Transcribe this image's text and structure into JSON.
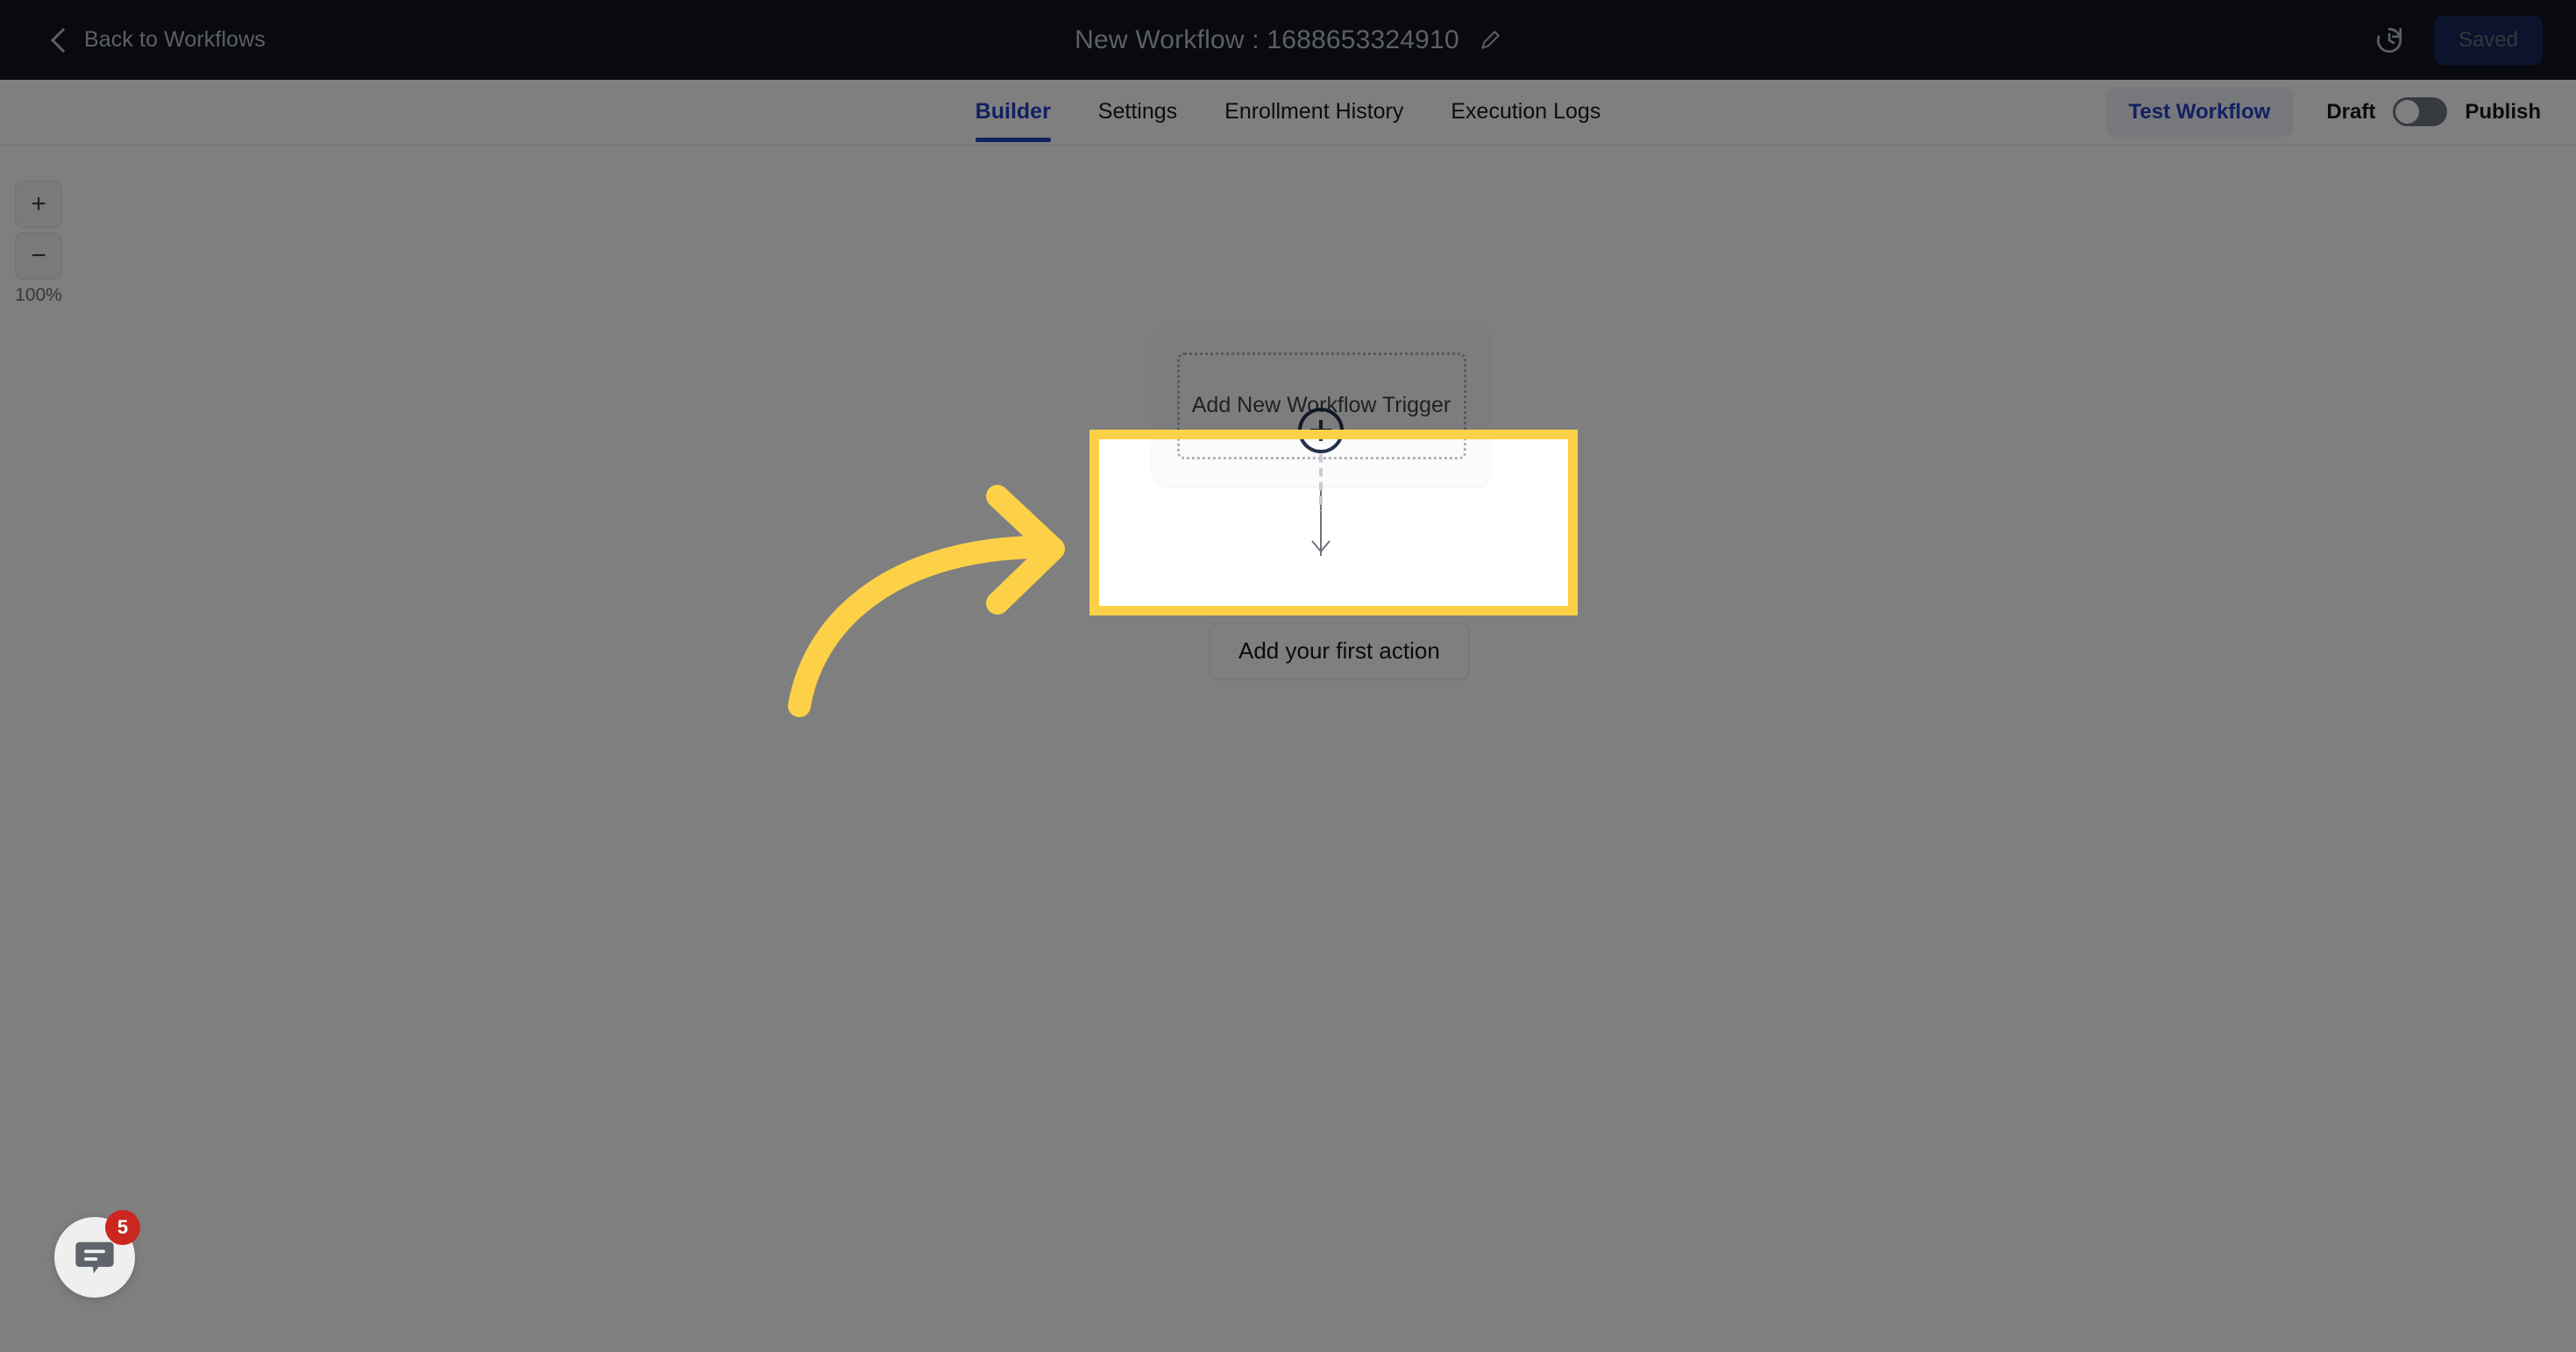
{
  "topbar": {
    "back_label": "Back to Workflows",
    "back_icon": "chevron-left-icon",
    "title": "New Workflow : 1688653324910",
    "edit_icon": "pencil-icon",
    "history_icon": "history-clock-icon",
    "save_label": "Saved",
    "bg_color": "#111520",
    "text_color": "#b9bec7",
    "save_bg_color": "#17265a"
  },
  "tabbar": {
    "tabs": [
      {
        "label": "Builder",
        "active": true
      },
      {
        "label": "Settings",
        "active": false
      },
      {
        "label": "Enrollment History",
        "active": false
      },
      {
        "label": "Execution Logs",
        "active": false
      }
    ],
    "test_workflow_label": "Test Workflow",
    "draft_label": "Draft",
    "publish_label": "Publish",
    "toggle_state": "off",
    "accent_color": "#2241c4"
  },
  "canvas": {
    "zoom": {
      "zoom_in_label": "+",
      "zoom_out_label": "−",
      "level_label": "100%"
    },
    "trigger_node": {
      "label": "Add New Workflow Trigger"
    },
    "add_step_button": {
      "icon": "plus-circle-icon"
    },
    "first_action_button": {
      "label": "Add your first action"
    }
  },
  "annotation": {
    "highlight_color": "#fcd147",
    "arrow_icon": "curved-arrow-right-icon",
    "overlay_color": "rgba(0,0,0,0.50)"
  },
  "chat_widget": {
    "icon": "chat-bubble-icon",
    "badge_count": "5",
    "badge_color": "#c9271f"
  }
}
